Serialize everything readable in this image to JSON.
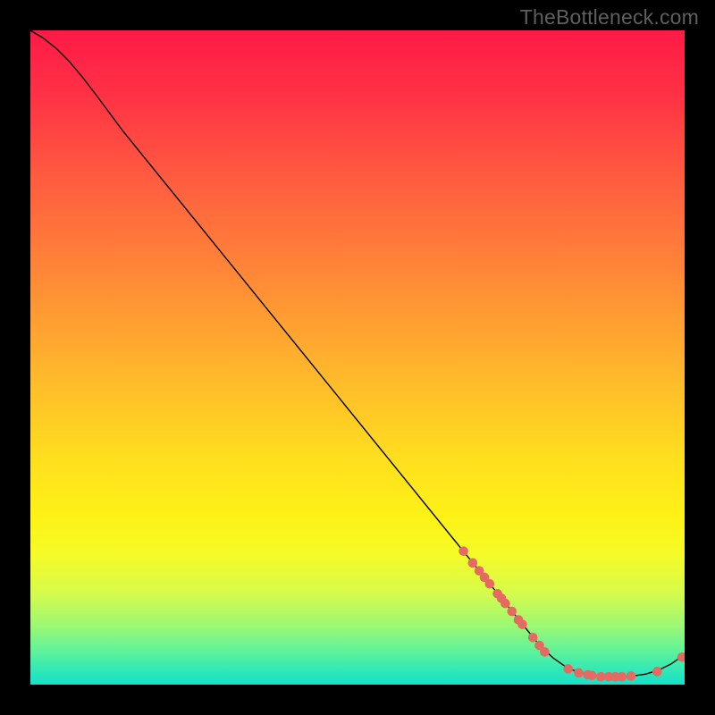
{
  "watermark": "TheBottleneck.com",
  "chart_data": {
    "type": "line",
    "title": "",
    "xlabel": "",
    "ylabel": "",
    "xlim": [
      0,
      100
    ],
    "ylim": [
      0,
      100
    ],
    "background_gradient_stops": [
      {
        "offset": 0.0,
        "color": "#ff1a47"
      },
      {
        "offset": 0.1,
        "color": "#ff3245"
      },
      {
        "offset": 0.22,
        "color": "#ff5a40"
      },
      {
        "offset": 0.36,
        "color": "#ff8438"
      },
      {
        "offset": 0.52,
        "color": "#ffb62c"
      },
      {
        "offset": 0.66,
        "color": "#ffe01e"
      },
      {
        "offset": 0.74,
        "color": "#fdf116"
      },
      {
        "offset": 0.8,
        "color": "#f6fb27"
      },
      {
        "offset": 0.86,
        "color": "#d6fb4b"
      },
      {
        "offset": 0.91,
        "color": "#9cf873"
      },
      {
        "offset": 0.95,
        "color": "#5df29b"
      },
      {
        "offset": 0.98,
        "color": "#2de8b9"
      },
      {
        "offset": 1.0,
        "color": "#19e0c7"
      }
    ],
    "series": [
      {
        "name": "bottleneck-curve",
        "color": "#000000",
        "width": 1.4,
        "points": [
          {
            "x": 0.0,
            "y": 100.0
          },
          {
            "x": 2.0,
            "y": 98.8
          },
          {
            "x": 4.0,
            "y": 97.2
          },
          {
            "x": 6.0,
            "y": 95.2
          },
          {
            "x": 8.0,
            "y": 92.8
          },
          {
            "x": 10.0,
            "y": 90.2
          },
          {
            "x": 12.0,
            "y": 87.5
          },
          {
            "x": 14.0,
            "y": 84.8
          },
          {
            "x": 78.0,
            "y": 5.8
          },
          {
            "x": 80.0,
            "y": 4.0
          },
          {
            "x": 82.0,
            "y": 2.6
          },
          {
            "x": 84.0,
            "y": 1.8
          },
          {
            "x": 86.0,
            "y": 1.4
          },
          {
            "x": 88.0,
            "y": 1.2
          },
          {
            "x": 90.0,
            "y": 1.2
          },
          {
            "x": 92.0,
            "y": 1.3
          },
          {
            "x": 94.0,
            "y": 1.6
          },
          {
            "x": 96.0,
            "y": 2.2
          },
          {
            "x": 98.0,
            "y": 3.2
          },
          {
            "x": 100.0,
            "y": 4.6
          }
        ]
      }
    ],
    "markers": {
      "color": "#e56a62",
      "radius": 5.3,
      "points": [
        {
          "x": 66.2,
          "y": 20.4
        },
        {
          "x": 67.6,
          "y": 18.6
        },
        {
          "x": 68.6,
          "y": 17.4
        },
        {
          "x": 69.4,
          "y": 16.4
        },
        {
          "x": 70.2,
          "y": 15.4
        },
        {
          "x": 71.4,
          "y": 13.9
        },
        {
          "x": 72.0,
          "y": 13.2
        },
        {
          "x": 72.6,
          "y": 12.4
        },
        {
          "x": 73.6,
          "y": 11.2
        },
        {
          "x": 74.6,
          "y": 9.9
        },
        {
          "x": 75.2,
          "y": 9.2
        },
        {
          "x": 76.8,
          "y": 7.2
        },
        {
          "x": 77.8,
          "y": 6.0
        },
        {
          "x": 78.6,
          "y": 5.0
        },
        {
          "x": 82.2,
          "y": 2.4
        },
        {
          "x": 83.8,
          "y": 1.8
        },
        {
          "x": 85.2,
          "y": 1.5
        },
        {
          "x": 85.8,
          "y": 1.4
        },
        {
          "x": 87.2,
          "y": 1.2
        },
        {
          "x": 88.4,
          "y": 1.2
        },
        {
          "x": 89.4,
          "y": 1.2
        },
        {
          "x": 90.4,
          "y": 1.2
        },
        {
          "x": 91.8,
          "y": 1.3
        },
        {
          "x": 95.8,
          "y": 2.0
        },
        {
          "x": 99.6,
          "y": 4.2
        }
      ]
    }
  }
}
